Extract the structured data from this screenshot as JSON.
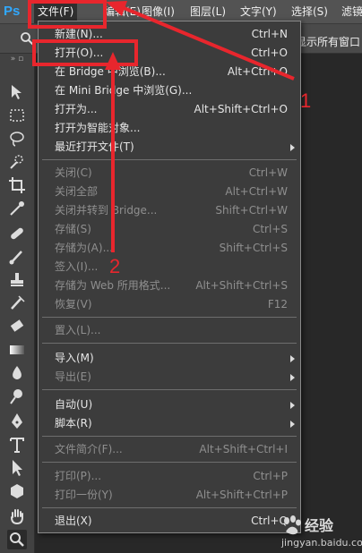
{
  "app": {
    "logo": "Ps"
  },
  "menubar": {
    "items": [
      {
        "label": "文件(F)",
        "active": true
      },
      {
        "label": "编辑(E)"
      },
      {
        "label": "图像(I)"
      },
      {
        "label": "图层(L)"
      },
      {
        "label": "文字(Y)"
      },
      {
        "label": "选择(S)"
      },
      {
        "label": "滤镜"
      }
    ]
  },
  "options_bar": {
    "right_text": "显示所有窗口"
  },
  "file_menu": {
    "items": [
      {
        "label": "新建(N)...",
        "shortcut": "Ctrl+N",
        "enabled": true
      },
      {
        "label": "打开(O)...",
        "shortcut": "Ctrl+O",
        "enabled": true
      },
      {
        "label": "在 Bridge 中浏览(B)...",
        "shortcut": "Alt+Ctrl+O",
        "enabled": true
      },
      {
        "label": "在 Mini Bridge 中浏览(G)...",
        "shortcut": "",
        "enabled": true
      },
      {
        "label": "打开为...",
        "shortcut": "Alt+Shift+Ctrl+O",
        "enabled": true
      },
      {
        "label": "打开为智能对象...",
        "shortcut": "",
        "enabled": true
      },
      {
        "label": "最近打开文件(T)",
        "shortcut": "",
        "enabled": true,
        "submenu": true
      },
      {
        "label": "关闭(C)",
        "shortcut": "Ctrl+W",
        "enabled": false
      },
      {
        "label": "关闭全部",
        "shortcut": "Alt+Ctrl+W",
        "enabled": false
      },
      {
        "label": "关闭并转到 Bridge...",
        "shortcut": "Shift+Ctrl+W",
        "enabled": false
      },
      {
        "label": "存储(S)",
        "shortcut": "Ctrl+S",
        "enabled": false
      },
      {
        "label": "存储为(A)...",
        "shortcut": "Shift+Ctrl+S",
        "enabled": false
      },
      {
        "label": "签入(I)...",
        "shortcut": "",
        "enabled": false
      },
      {
        "label": "存储为 Web 所用格式...",
        "shortcut": "Alt+Shift+Ctrl+S",
        "enabled": false
      },
      {
        "label": "恢复(V)",
        "shortcut": "F12",
        "enabled": false
      },
      {
        "label": "置入(L)...",
        "shortcut": "",
        "enabled": false
      },
      {
        "label": "导入(M)",
        "shortcut": "",
        "enabled": true,
        "submenu": true
      },
      {
        "label": "导出(E)",
        "shortcut": "",
        "enabled": false,
        "submenu": true
      },
      {
        "label": "自动(U)",
        "shortcut": "",
        "enabled": true,
        "submenu": true
      },
      {
        "label": "脚本(R)",
        "shortcut": "",
        "enabled": true,
        "submenu": true
      },
      {
        "label": "文件简介(F)...",
        "shortcut": "Alt+Shift+Ctrl+I",
        "enabled": false
      },
      {
        "label": "打印(P)...",
        "shortcut": "Ctrl+P",
        "enabled": false
      },
      {
        "label": "打印一份(Y)",
        "shortcut": "Alt+Shift+Ctrl+P",
        "enabled": false
      },
      {
        "label": "退出(X)",
        "shortcut": "Ctrl+Q",
        "enabled": true
      }
    ]
  },
  "annotations": {
    "num1": "1",
    "num2": "2",
    "color": "#e8262d"
  },
  "watermark": {
    "main": "经验",
    "sub": "jingyan.baidu.com"
  }
}
